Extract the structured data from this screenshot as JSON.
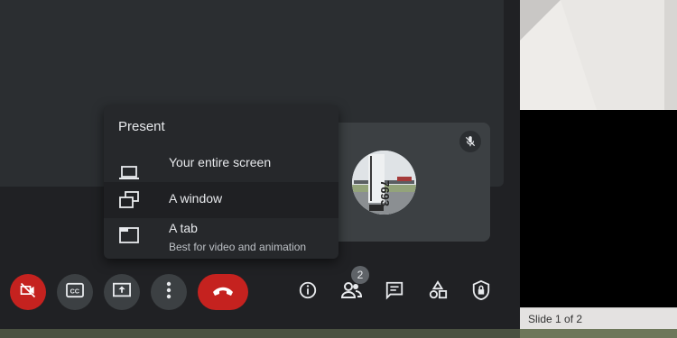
{
  "present_menu": {
    "title": "Present",
    "items": [
      {
        "label": "Your entire screen",
        "icon": "laptop-icon"
      },
      {
        "label": "A window",
        "icon": "window-icon"
      },
      {
        "label": "A tab",
        "sublabel": "Best for video and animation",
        "icon": "tab-icon"
      }
    ]
  },
  "toolbar": {
    "left_buttons": [
      "camera-off-icon",
      "closed-captions-icon",
      "present-screen-icon",
      "more-options-icon",
      "hang-up-icon"
    ],
    "right_buttons": [
      "info-icon",
      "people-icon",
      "chat-icon",
      "activities-icon",
      "host-controls-icon"
    ],
    "participant_count": "2"
  },
  "slide_pane": {
    "status_text": "Slide 1 of 2"
  },
  "colors": {
    "background": "#202124",
    "panel": "#2b2e31",
    "menu": "#26282b",
    "danger": "#c5221f",
    "tile": "#3c4043"
  }
}
